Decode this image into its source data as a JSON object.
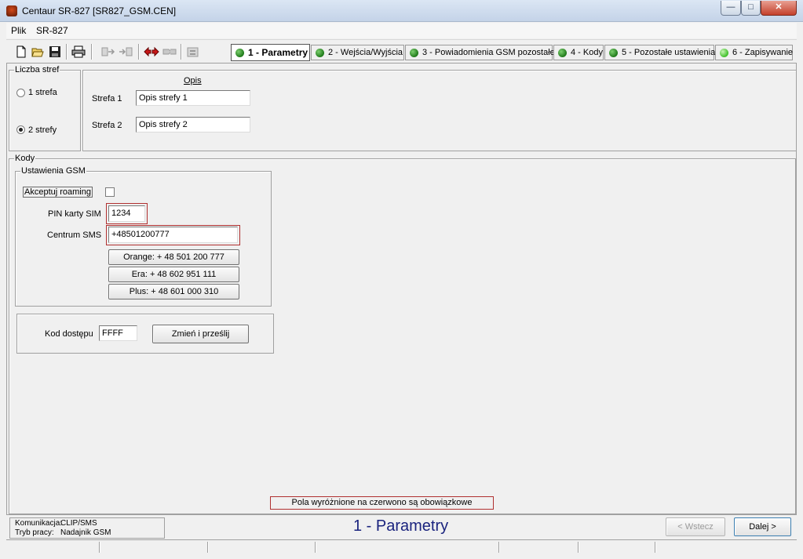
{
  "window": {
    "title": "Centaur SR-827   [SR827_GSM.CEN]",
    "minimize": "—",
    "maximize": "□",
    "close": "✕"
  },
  "menu": [
    "Plik",
    "SR-827"
  ],
  "toolbar": {
    "icons": [
      "new-file-icon",
      "open-folder-icon",
      "save-icon",
      "print-icon",
      "read-device-icon",
      "write-device-icon",
      "transfer-both-icon",
      "transfer-disabled-icon",
      "device-settings-icon"
    ]
  },
  "tabs": [
    {
      "label": "1 - Parametry",
      "status": "dark"
    },
    {
      "label": "2 - Wejścia/Wyjścia",
      "status": "dark"
    },
    {
      "label": "3 - Powiadomienia GSM pozostałe",
      "status": "dark"
    },
    {
      "label": "4 - Kody",
      "status": "dark"
    },
    {
      "label": "5 - Pozostałe ustawienia",
      "status": "dark"
    },
    {
      "label": "6 - Zapisywanie",
      "status": "light"
    }
  ],
  "zones": {
    "group_title": "Liczba stref",
    "options": [
      {
        "label": "1 strefa",
        "checked": false
      },
      {
        "label": "2 strefy",
        "checked": true
      }
    ]
  },
  "descriptions": {
    "header": "Opis",
    "rows": [
      {
        "label": "Strefa 1",
        "value": "Opis strefy 1"
      },
      {
        "label": "Strefa 2",
        "value": "Opis strefy 2"
      }
    ]
  },
  "codes": {
    "group_title": "Kody",
    "gsm": {
      "group_title": "Ustawienia GSM",
      "roaming_label": "Akceptuj roaming",
      "roaming_checked": false,
      "pin_label": "PIN karty SIM",
      "pin_value": "1234",
      "sms_label": "Centrum SMS",
      "sms_value": "+48501200777",
      "operators": [
        "Orange: + 48 501 200 777",
        "Era: + 48 602 951 111",
        "Plus: + 48 601 000 310"
      ]
    },
    "access": {
      "label": "Kod dostępu",
      "value": "FFFF",
      "button": "Zmień i prześlij"
    }
  },
  "notice": "Pola wyróżnione na czerwono są obowiązkowe",
  "status": {
    "comm_label": "Komunikacja:",
    "comm_value": "CLIP/SMS",
    "mode_label": "Tryb pracy:",
    "mode_value": "Nadajnik GSM"
  },
  "step_title": "1 - Parametry",
  "nav": {
    "back": "< Wstecz",
    "next": "Dalej >"
  },
  "colors": {
    "required_border": "#b03030",
    "step_title": "#1a237e",
    "status_done": "#1f7a1a",
    "status_current": "#3fbf2a"
  }
}
